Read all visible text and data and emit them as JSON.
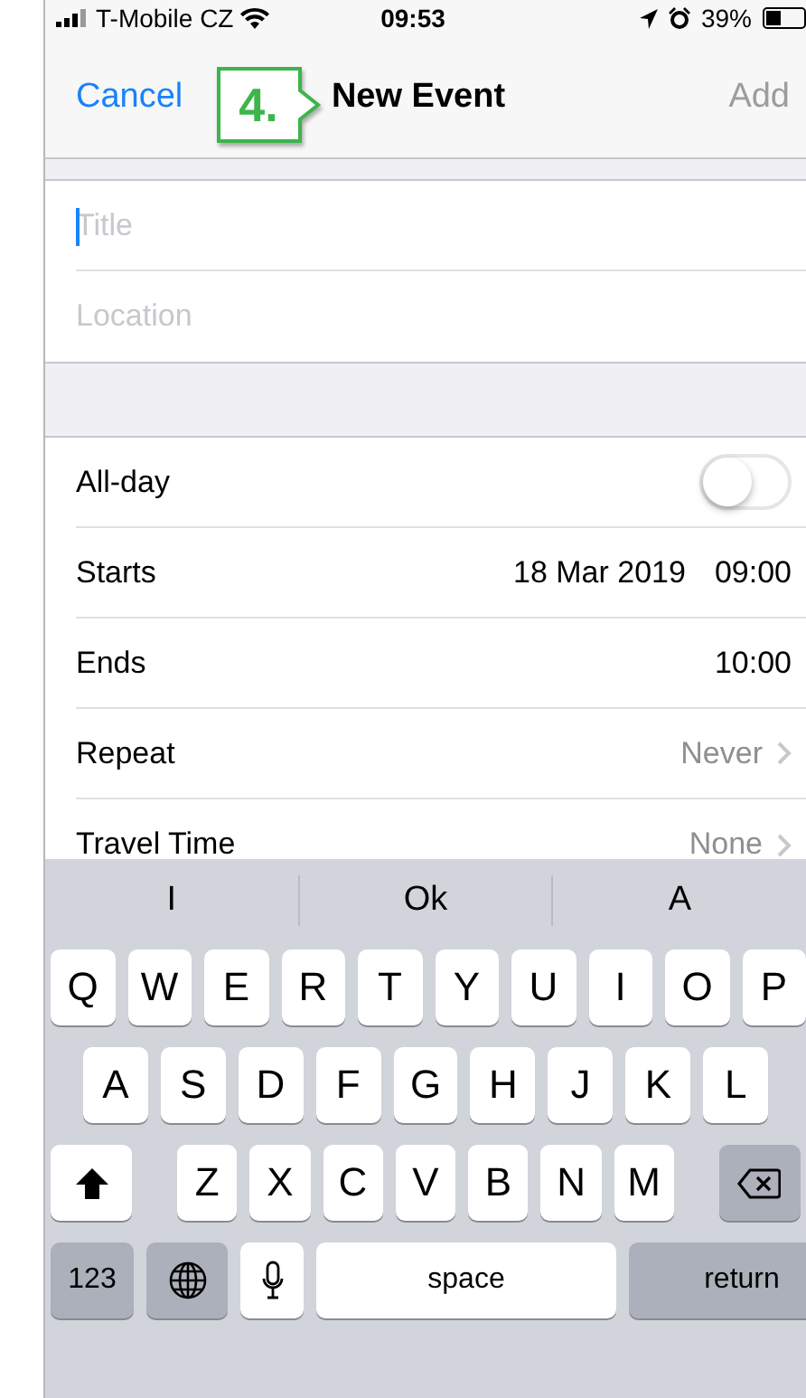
{
  "status_bar": {
    "carrier": "T-Mobile CZ",
    "time": "09:53",
    "battery": "39%"
  },
  "nav": {
    "cancel": "Cancel",
    "title": "New Event",
    "add": {
      "label": "Add",
      "disabled": true
    }
  },
  "callout": {
    "label": "4."
  },
  "fields": [
    {
      "placeholder": "Title",
      "focused": true
    },
    {
      "placeholder": "Location",
      "focused": false
    }
  ],
  "rows": [
    {
      "kind": "switch",
      "label": "All-day",
      "on": false
    },
    {
      "kind": "value",
      "label": "Starts",
      "values": [
        "18 Mar 2019",
        "09:00"
      ]
    },
    {
      "kind": "value",
      "label": "Ends",
      "values": [
        "10:00"
      ]
    },
    {
      "kind": "link",
      "label": "Repeat",
      "value": "Never"
    },
    {
      "kind": "link",
      "label": "Travel Time",
      "value": "None"
    }
  ],
  "suggestions": [
    "I",
    "Ok",
    "A"
  ],
  "keyboard": {
    "rows": [
      [
        "Q",
        "W",
        "E",
        "R",
        "T",
        "Y",
        "U",
        "I",
        "O",
        "P"
      ],
      [
        "A",
        "S",
        "D",
        "F",
        "G",
        "H",
        "J",
        "K",
        "L"
      ],
      [
        "Z",
        "X",
        "C",
        "V",
        "B",
        "N",
        "M"
      ]
    ],
    "numbers": "123",
    "space": "space",
    "return": "return"
  }
}
